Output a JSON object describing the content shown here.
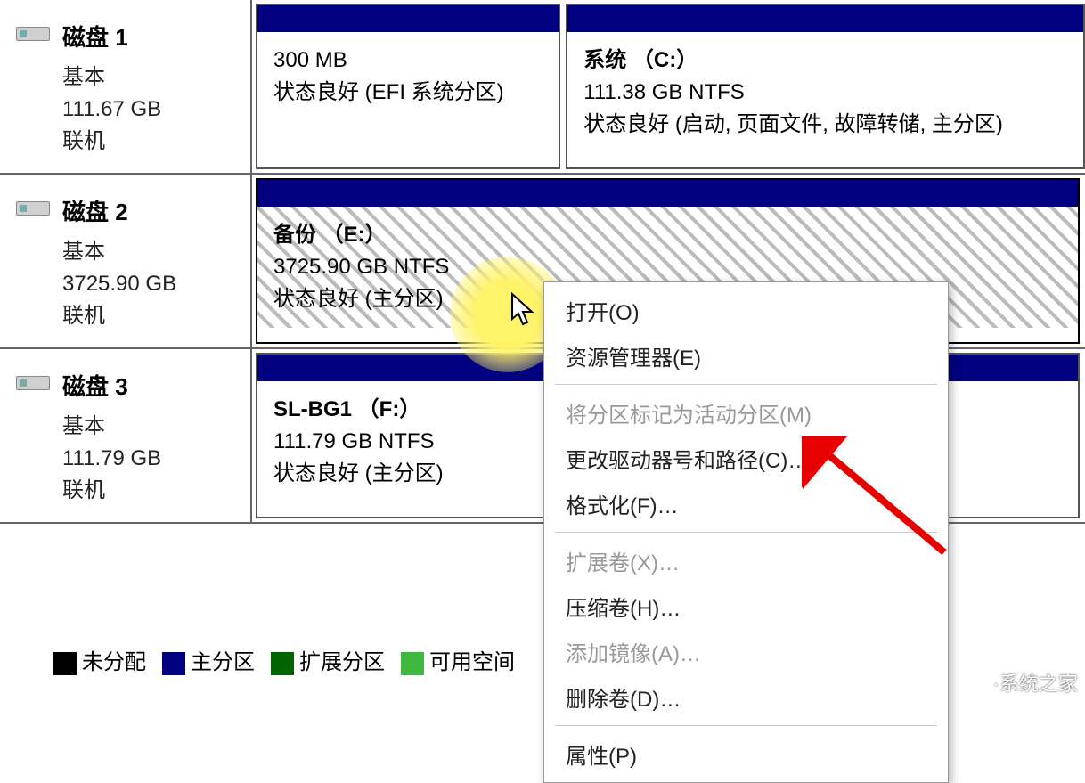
{
  "disks": [
    {
      "name": "磁盘 1",
      "type": "基本",
      "size": "111.67 GB",
      "status": "联机",
      "partitions": [
        {
          "title": "",
          "size": "300 MB",
          "status": "状态良好 (EFI 系统分区)",
          "widthPct": 37,
          "selected": false,
          "hatched": false
        },
        {
          "title": "系统 （C:）",
          "size": "111.38 GB NTFS",
          "status": "状态良好 (启动, 页面文件, 故障转储, 主分区)",
          "widthPct": 63,
          "selected": false,
          "hatched": false
        }
      ]
    },
    {
      "name": "磁盘 2",
      "type": "基本",
      "size": "3725.90 GB",
      "status": "联机",
      "partitions": [
        {
          "title": "备份 （E:）",
          "size": "3725.90 GB NTFS",
          "status": "状态良好 (主分区)",
          "widthPct": 100,
          "selected": true,
          "hatched": true
        }
      ]
    },
    {
      "name": "磁盘 3",
      "type": "基本",
      "size": "111.79 GB",
      "status": "联机",
      "partitions": [
        {
          "title": "SL-BG1 （F:）",
          "size": "111.79 GB NTFS",
          "status": "状态良好 (主分区)",
          "widthPct": 100,
          "selected": false,
          "hatched": false
        }
      ]
    }
  ],
  "legend": {
    "unallocated": "未分配",
    "primary": "主分区",
    "extended": "扩展分区",
    "free": "可用空间"
  },
  "context_menu": [
    {
      "label": "打开(O)",
      "enabled": true
    },
    {
      "label": "资源管理器(E)",
      "enabled": true
    },
    {
      "sep": true
    },
    {
      "label": "将分区标记为活动分区(M)",
      "enabled": false
    },
    {
      "label": "更改驱动器号和路径(C)…",
      "enabled": true
    },
    {
      "label": "格式化(F)…",
      "enabled": true
    },
    {
      "sep": true
    },
    {
      "label": "扩展卷(X)…",
      "enabled": false
    },
    {
      "label": "压缩卷(H)…",
      "enabled": true
    },
    {
      "label": "添加镜像(A)…",
      "enabled": false
    },
    {
      "label": "删除卷(D)…",
      "enabled": true
    },
    {
      "sep": true
    },
    {
      "label": "属性(P)",
      "enabled": true
    }
  ],
  "watermark": {
    "text": "·系统之家"
  }
}
